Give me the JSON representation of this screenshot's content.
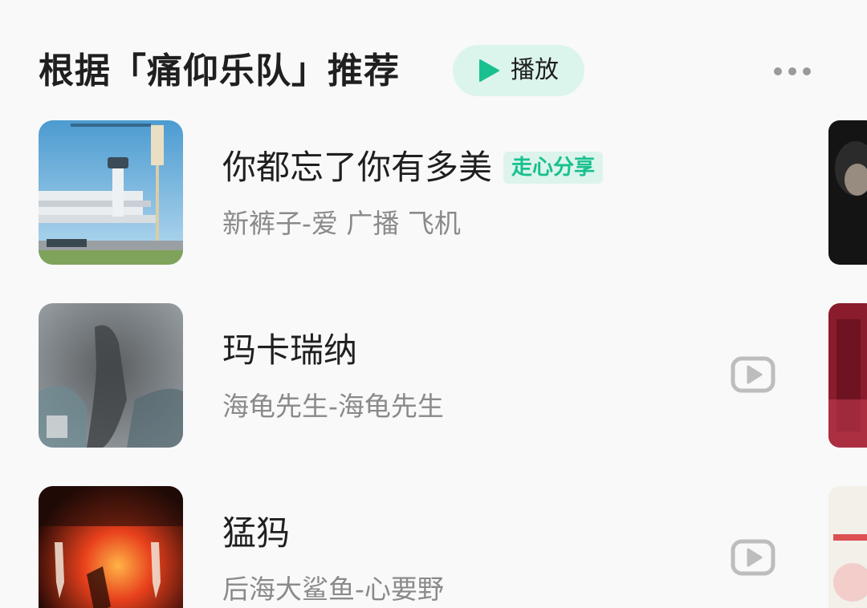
{
  "header": {
    "title": "根据「痛仰乐队」推荐",
    "play_label": "播放"
  },
  "songs": [
    {
      "title": "你都忘了你有多美",
      "tag": "走心分享",
      "subtitle": "新裤子-爱 广播 飞机",
      "has_mv": false
    },
    {
      "title": "玛卡瑞纳",
      "subtitle": "海龟先生-海龟先生",
      "has_mv": true
    },
    {
      "title": "猛犸",
      "subtitle": "后海大鲨鱼-心要野",
      "has_mv": true
    }
  ],
  "colors": {
    "accent": "#18c08f",
    "play_pill": "#dcf5ec",
    "tag_bg": "#ddf4ec",
    "title_text": "#1f1f1f",
    "sub_text": "#8a8a8a",
    "background": "#f9f9fa"
  },
  "icons": {
    "play": "play-triangle-icon",
    "more": "more-dots-icon",
    "mv": "video-play-icon"
  }
}
